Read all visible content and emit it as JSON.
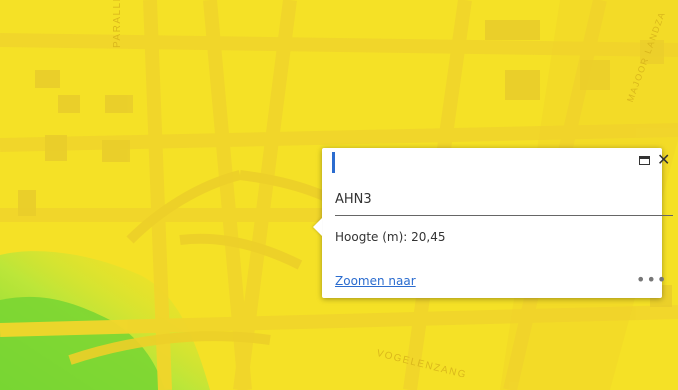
{
  "map": {
    "labels": {
      "parallelweg": "PARALLELWEG",
      "majoor": "MAJOOR LANDZA",
      "vogelenzang": "VOGELENZANG"
    },
    "colors": {
      "base": "#f5e126",
      "roads": "#f0d82a",
      "blocks": "#e9cd2b",
      "green": "#9be03a"
    }
  },
  "popup": {
    "title": "AHN3",
    "content": "Hoogte (m): 20,45",
    "zoom_link": "Zoomen naar",
    "more_icon": "•••",
    "maximize_icon": "maximize-icon",
    "close_glyph": "✕"
  }
}
